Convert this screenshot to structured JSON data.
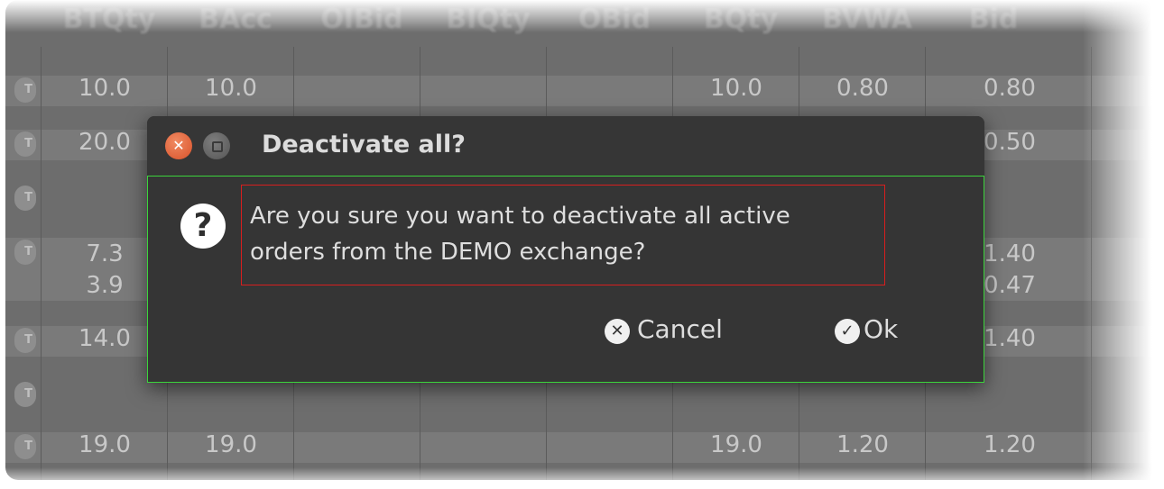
{
  "table": {
    "headers": [
      "BTQty",
      "BAcc",
      "OIBid",
      "BIQty",
      "OBid",
      "BQty",
      "BVWA",
      "Bid"
    ],
    "rows": [
      {
        "c0": "10.0",
        "c1": "10.0",
        "c5": "10.0",
        "c6": "0.80",
        "c7": "0.80"
      },
      {
        "c0": "20.0",
        "c7": "0.50"
      },
      {},
      {
        "c0": "7.3",
        "c0b": "3.9",
        "c7": "1.40",
        "c7b": "0.47"
      },
      {
        "c0": "14.0",
        "c7": "1.40"
      },
      {},
      {
        "c0": "19.0",
        "c1": "19.0",
        "c5": "19.0",
        "c6": "1.20",
        "c7": "1.20"
      }
    ]
  },
  "dialog": {
    "title": "Deactivate all?",
    "message_line1": "Are you sure you want to deactivate all active",
    "message_line2": "orders from the DEMO exchange?",
    "cancel_label": "Cancel",
    "ok_label": "Ok",
    "close_icon": "close-icon",
    "maximize_icon": "maximize-icon",
    "question_icon": "question-icon"
  }
}
